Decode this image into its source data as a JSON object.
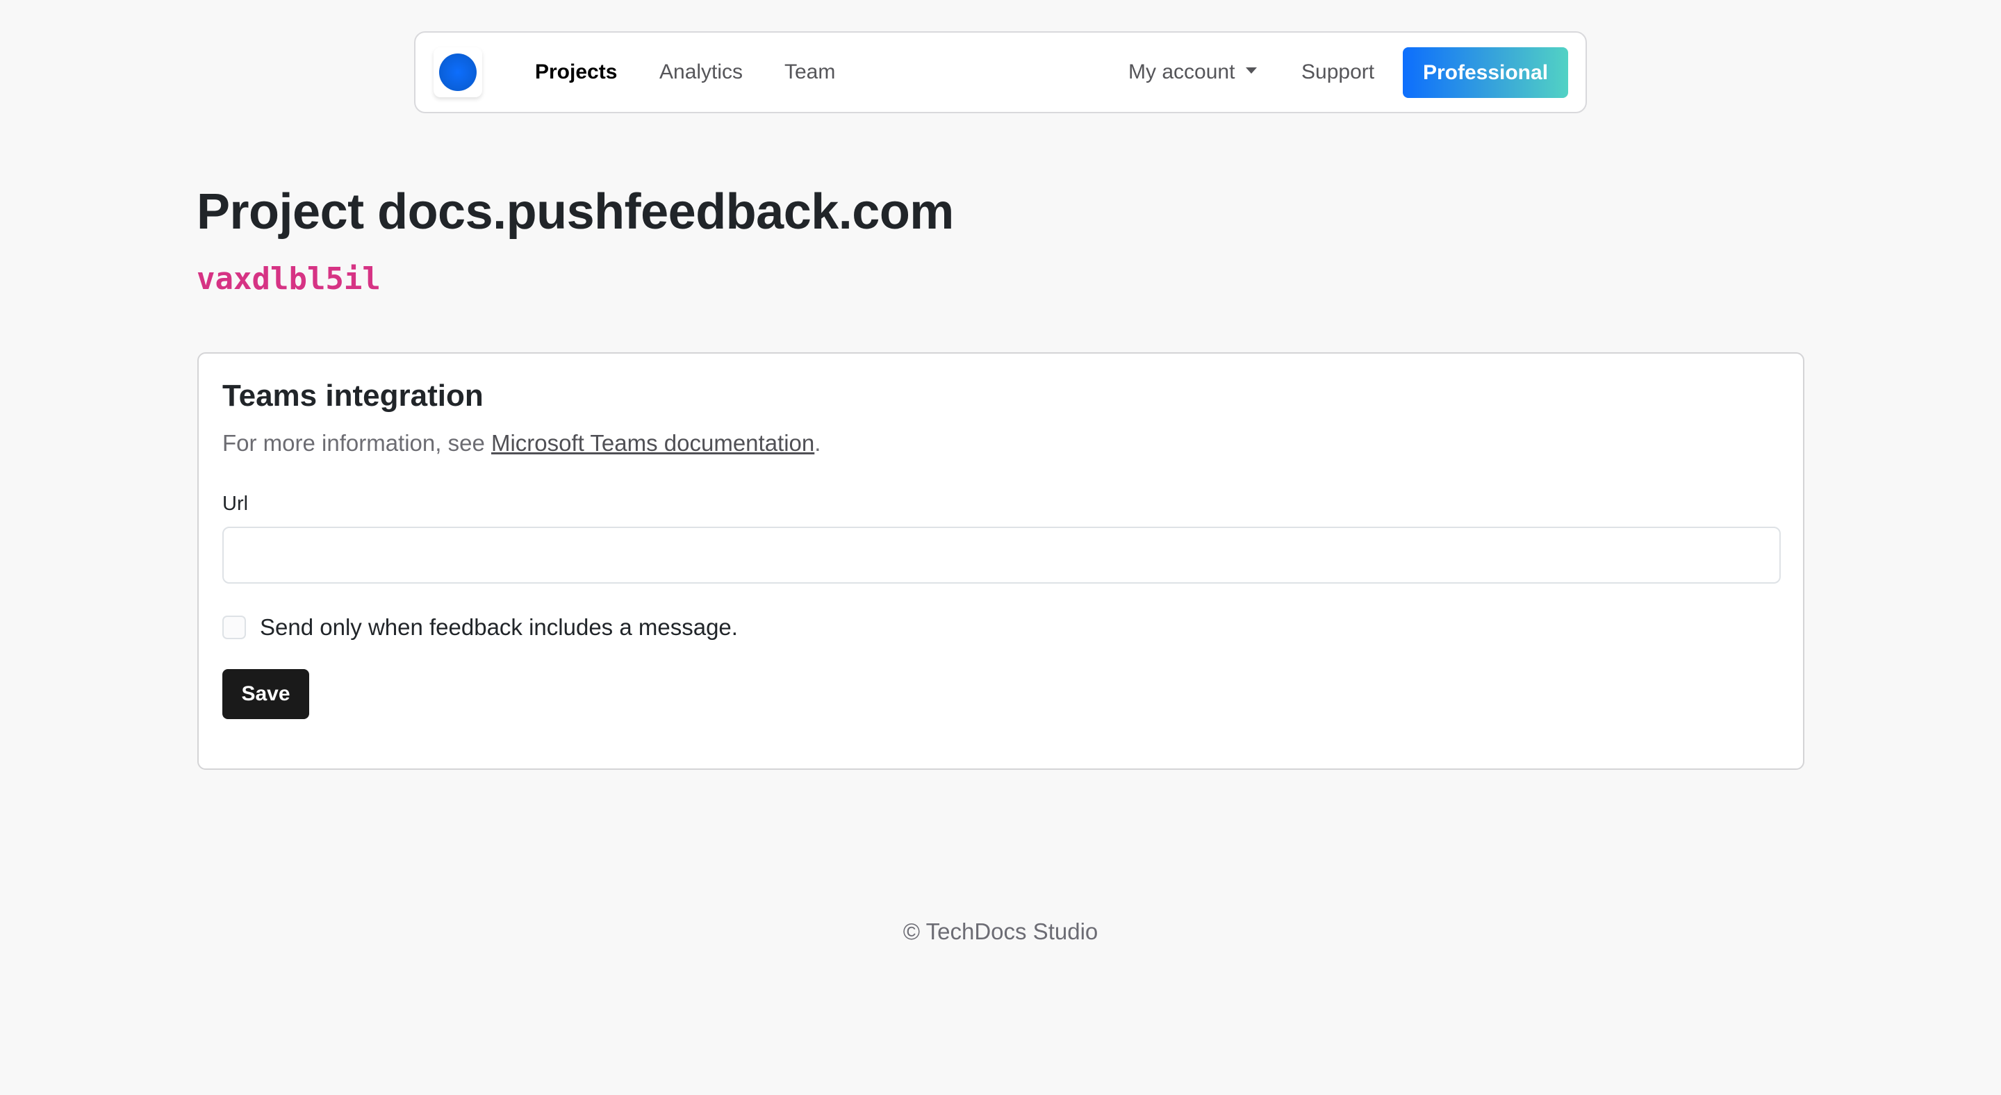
{
  "navbar": {
    "logo_icon": "blue-circle-logo",
    "links": [
      {
        "label": "Projects",
        "active": true
      },
      {
        "label": "Analytics",
        "active": false
      },
      {
        "label": "Team",
        "active": false
      }
    ],
    "account_label": "My account",
    "account_icon": "caret-down-icon",
    "support_label": "Support",
    "plan_button_label": "Professional",
    "plan_button_gradient": [
      "#0d6efd",
      "#52d2c4"
    ]
  },
  "page": {
    "title": "Project docs.pushfeedback.com",
    "project_key": "vaxdlbl5il",
    "project_key_color": "#d63384"
  },
  "card": {
    "title": "Teams integration",
    "description_prefix": "For more information, see ",
    "description_link": "Microsoft Teams documentation",
    "description_suffix": ".",
    "url_label": "Url",
    "url_value": "",
    "url_placeholder": "",
    "checkbox_label": "Send only when feedback includes a message.",
    "checkbox_checked": false,
    "save_label": "Save"
  },
  "footer": {
    "text": "© TechDocs Studio"
  }
}
